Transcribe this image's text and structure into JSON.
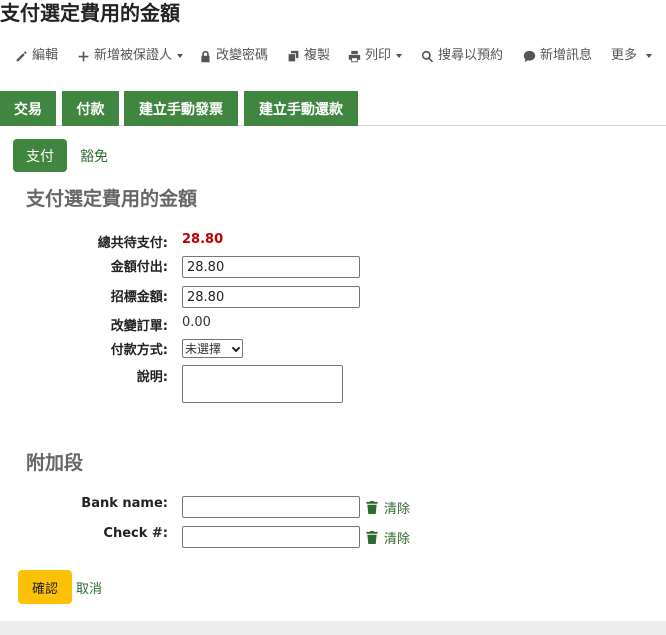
{
  "page": {
    "heading": "支付選定費用的金額"
  },
  "toolbar": {
    "edit": "編輯",
    "add_guarantor": "新增被保證人",
    "change_password": "改變密碼",
    "duplicate": "複製",
    "print": "列印",
    "search_hold": "搜尋以預約",
    "new_message": "新增訊息",
    "more": "更多"
  },
  "tabs": [
    "交易",
    "付款",
    "建立手動發票",
    "建立手動還款"
  ],
  "subtabs": {
    "pay": "支付",
    "writeoff": "豁免"
  },
  "form": {
    "title": "支付選定費用的金額",
    "total_label": "總共待支付:",
    "total_value": "28.80",
    "paid_label": "金額付出:",
    "paid_value": "28.80",
    "tendered_label": "招標金額:",
    "tendered_value": "28.80",
    "change_label": "改變訂單:",
    "change_value": "0.00",
    "method_label": "付款方式:",
    "method_selected": "未選擇",
    "note_label": "說明:"
  },
  "additional": {
    "title": "附加段",
    "bank_label": "Bank name:",
    "check_label": "Check #:",
    "clear": "清除"
  },
  "actions": {
    "confirm": "確認",
    "cancel": "取消"
  },
  "colors": {
    "accent_green": "#408540",
    "total_red": "#c00000",
    "confirm_yellow": "#ffc107"
  }
}
